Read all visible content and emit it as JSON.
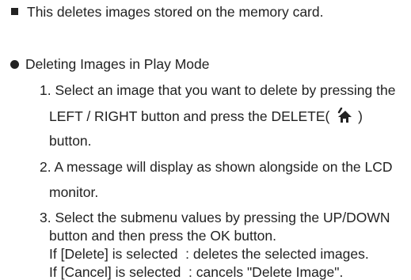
{
  "intro": {
    "text": "This deletes images stored on the memory card."
  },
  "section": {
    "heading": "Deleting Images in Play Mode",
    "step1": {
      "line1": "1. Select an image that you want to delete by pressing the",
      "line2_before": "LEFT / RIGHT button and press the DELETE(",
      "line2_after": ")",
      "line3": "button.",
      "icon": "trash-delete-icon"
    },
    "step2": {
      "line1": "2. A message will display as shown alongside on the LCD",
      "line2": "monitor."
    },
    "step3": {
      "line1": "3. Select the submenu values by pressing the UP/DOWN",
      "line2": "button and then press the OK button.",
      "option_delete": "If [Delete] is selected  : deletes the selected images.",
      "option_cancel": "If [Cancel] is selected  : cancels \"Delete Image\"."
    }
  }
}
